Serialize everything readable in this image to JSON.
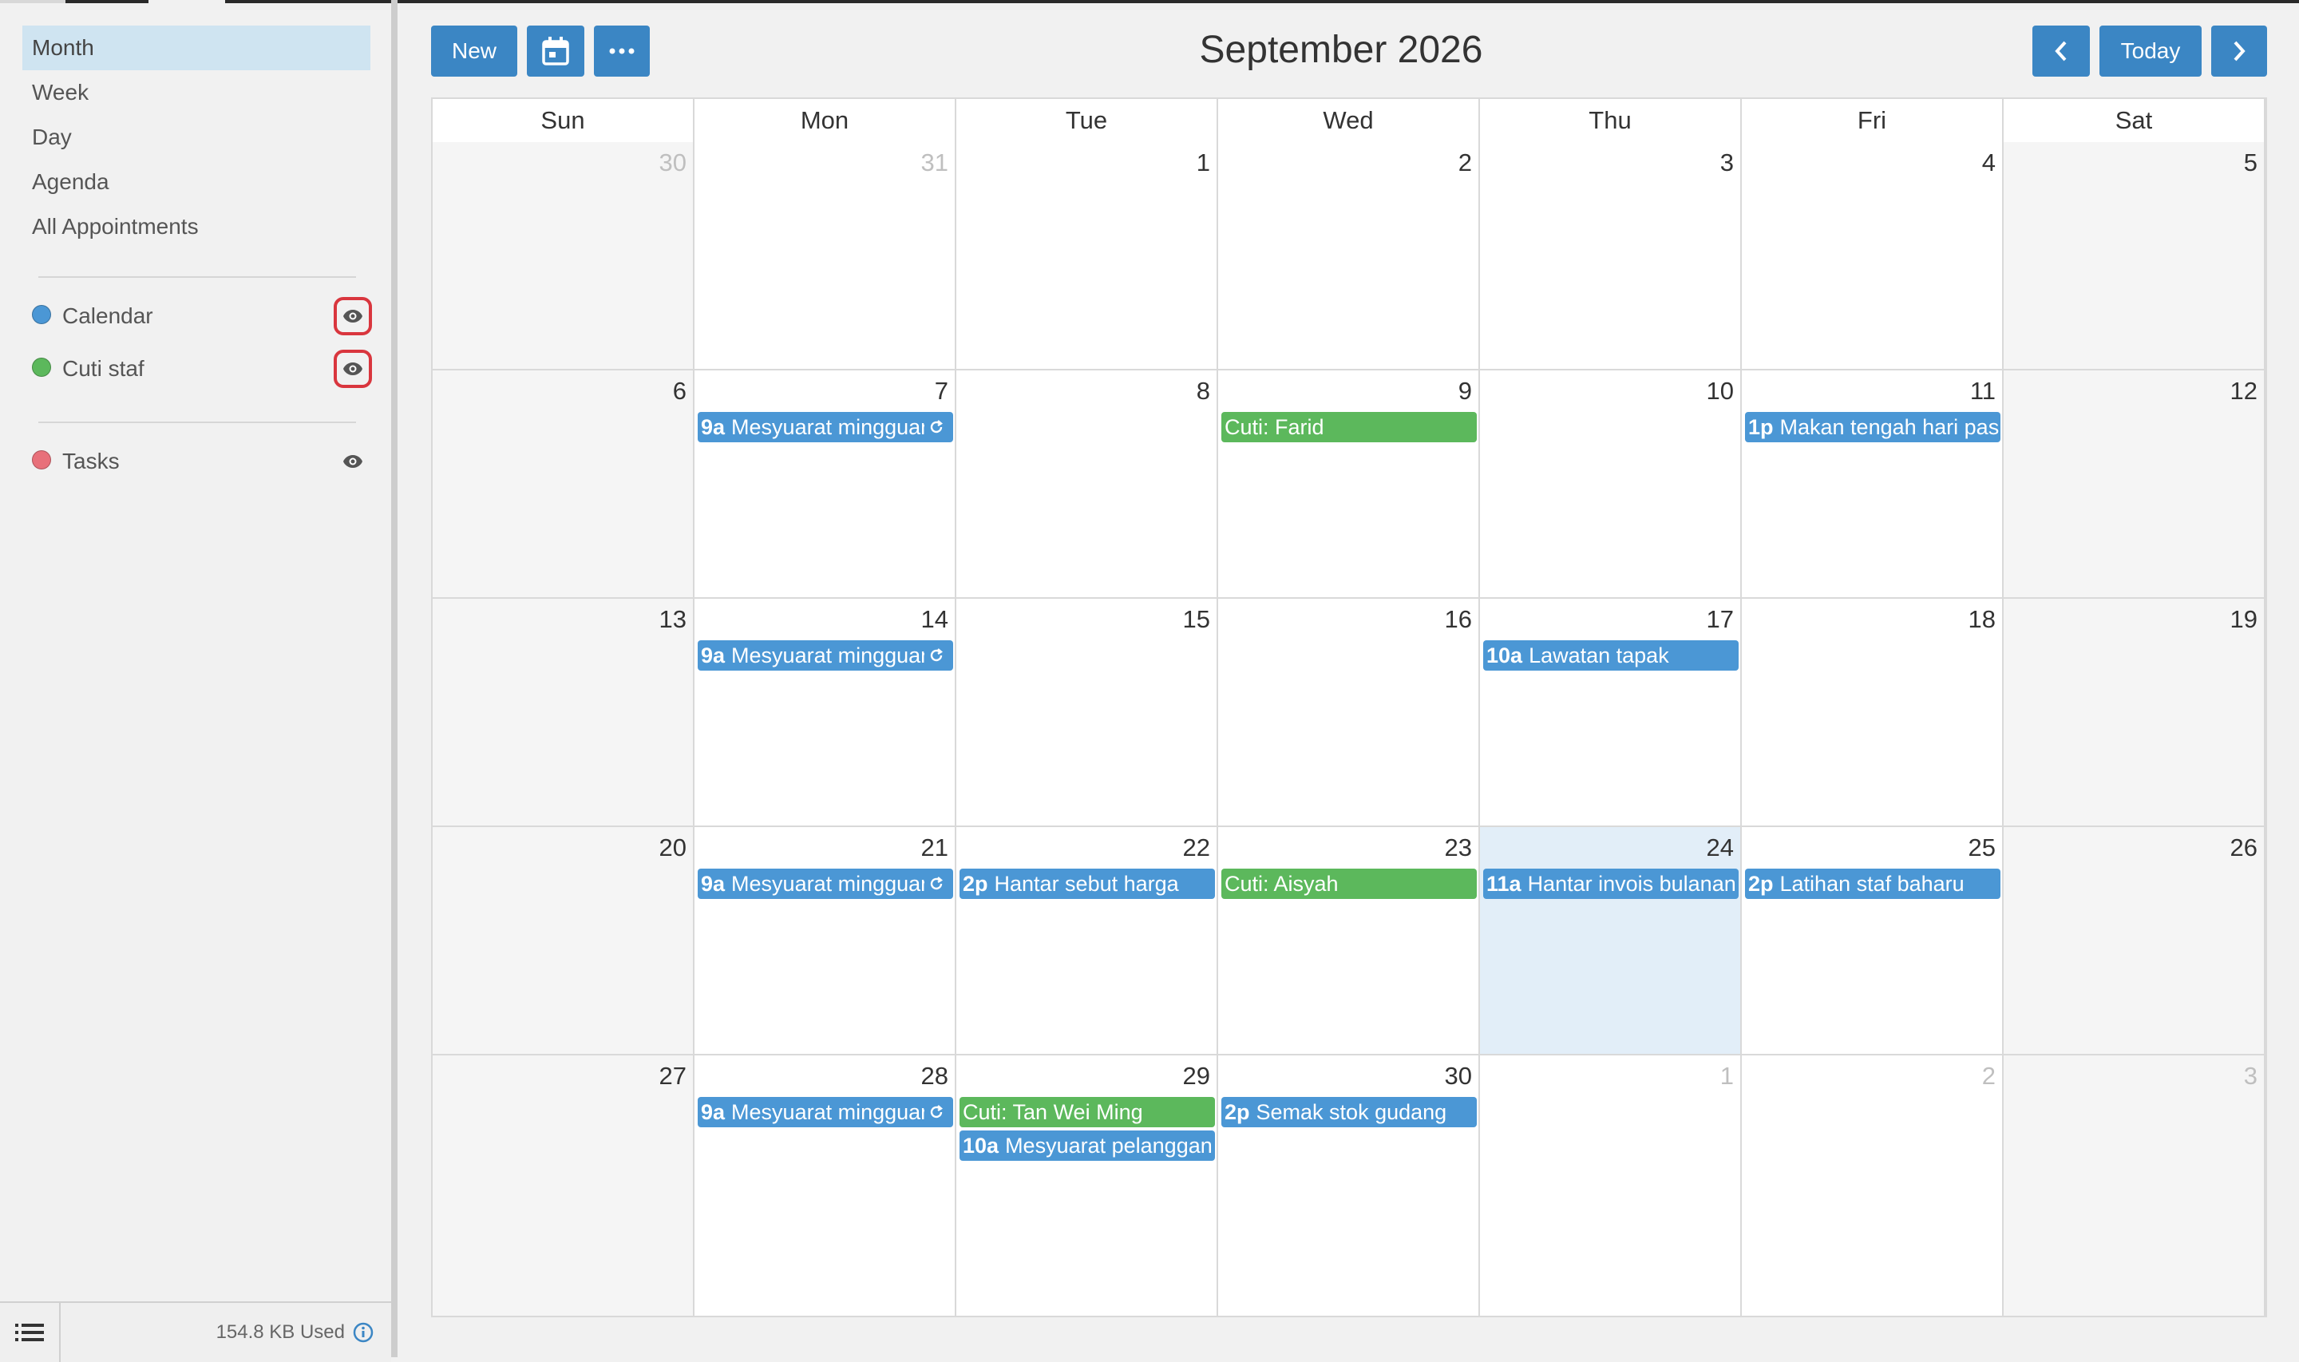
{
  "sidebar": {
    "views": [
      "Month",
      "Week",
      "Day",
      "Agenda",
      "All Appointments"
    ],
    "active_view": "Month",
    "calendars": [
      {
        "label": "Calendar",
        "color": "#4b97d5"
      },
      {
        "label": "Cuti staf",
        "color": "#5cb85c"
      }
    ],
    "tasks": {
      "label": "Tasks",
      "color": "#e8707a"
    },
    "storage": "154.8 KB Used"
  },
  "toolbar": {
    "new_label": "New",
    "today_label": "Today",
    "title": "September 2026"
  },
  "colors": {
    "accent": "#3b86c4",
    "event_blue": "#4b97d5",
    "event_green": "#5cb85c",
    "today_bg": "#e2eef8",
    "highlight": "#d9363e"
  },
  "calendar": {
    "weekdays": [
      "Sun",
      "Mon",
      "Tue",
      "Wed",
      "Thu",
      "Fri",
      "Sat"
    ],
    "weeks": [
      [
        {
          "d": "30",
          "o": true
        },
        {
          "d": "31",
          "o": true
        },
        {
          "d": "1"
        },
        {
          "d": "2"
        },
        {
          "d": "3"
        },
        {
          "d": "4"
        },
        {
          "d": "5"
        }
      ],
      [
        {
          "d": "6"
        },
        {
          "d": "7"
        },
        {
          "d": "8"
        },
        {
          "d": "9"
        },
        {
          "d": "10"
        },
        {
          "d": "11"
        },
        {
          "d": "12"
        }
      ],
      [
        {
          "d": "13"
        },
        {
          "d": "14"
        },
        {
          "d": "15"
        },
        {
          "d": "16"
        },
        {
          "d": "17"
        },
        {
          "d": "18"
        },
        {
          "d": "19"
        }
      ],
      [
        {
          "d": "20"
        },
        {
          "d": "21"
        },
        {
          "d": "22"
        },
        {
          "d": "23"
        },
        {
          "d": "24",
          "today": true
        },
        {
          "d": "25"
        },
        {
          "d": "26"
        }
      ],
      [
        {
          "d": "27"
        },
        {
          "d": "28"
        },
        {
          "d": "29"
        },
        {
          "d": "30"
        },
        {
          "d": "1",
          "o": true
        },
        {
          "d": "2",
          "o": true
        },
        {
          "d": "3",
          "o": true
        }
      ]
    ],
    "events": [
      {
        "week": 1,
        "day": 1,
        "slot": 0,
        "time": "9a",
        "title": "Mesyuarat mingguan",
        "color": "blue",
        "recurring": true
      },
      {
        "week": 1,
        "day": 3,
        "slot": 0,
        "time": "",
        "title": "Cuti: Farid",
        "color": "green"
      },
      {
        "week": 1,
        "day": 5,
        "slot": 0,
        "time": "1p",
        "title": "Makan tengah hari pasukan",
        "color": "blue"
      },
      {
        "week": 2,
        "day": 1,
        "slot": 0,
        "time": "9a",
        "title": "Mesyuarat mingguan",
        "color": "blue",
        "recurring": true
      },
      {
        "week": 2,
        "day": 4,
        "slot": 0,
        "time": "10a",
        "title": "Lawatan tapak",
        "color": "blue"
      },
      {
        "week": 3,
        "day": 1,
        "slot": 0,
        "time": "9a",
        "title": "Mesyuarat mingguan",
        "color": "blue",
        "recurring": true
      },
      {
        "week": 3,
        "day": 2,
        "slot": 0,
        "time": "2p",
        "title": "Hantar sebut harga",
        "color": "blue"
      },
      {
        "week": 3,
        "day": 3,
        "slot": 0,
        "time": "",
        "title": "Cuti: Aisyah",
        "color": "green"
      },
      {
        "week": 3,
        "day": 4,
        "slot": 0,
        "time": "11a",
        "title": "Hantar invois bulanan",
        "color": "blue"
      },
      {
        "week": 3,
        "day": 5,
        "slot": 0,
        "time": "2p",
        "title": "Latihan staf baharu",
        "color": "blue"
      },
      {
        "week": 4,
        "day": 1,
        "slot": 0,
        "time": "9a",
        "title": "Mesyuarat mingguan",
        "color": "blue",
        "recurring": true
      },
      {
        "week": 4,
        "day": 2,
        "slot": 0,
        "time": "",
        "title": "Cuti: Tan Wei Ming",
        "color": "green"
      },
      {
        "week": 4,
        "day": 2,
        "slot": 1,
        "time": "10a",
        "title": "Mesyuarat pelanggan",
        "color": "blue"
      },
      {
        "week": 4,
        "day": 3,
        "slot": 0,
        "time": "2p",
        "title": "Semak stok gudang",
        "color": "blue"
      }
    ]
  }
}
